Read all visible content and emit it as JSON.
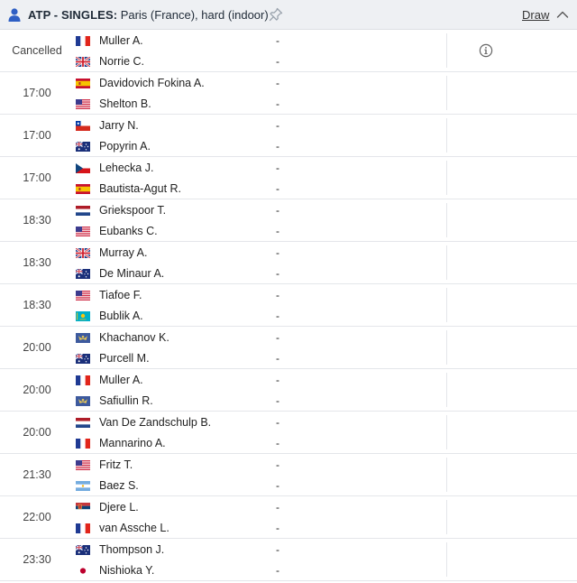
{
  "header": {
    "category": "ATP - SINGLES",
    "separator": ":",
    "tournament": "Paris (France), hard (indoor)",
    "draw_label": "Draw",
    "icons": {
      "person": "person-icon",
      "pin": "pin-icon",
      "collapse": "chevron-up-icon"
    },
    "accent_color": "#2e5fc4"
  },
  "matches": [
    {
      "time": "Cancelled",
      "p1": {
        "name": "Muller A.",
        "flag": "fr",
        "score": "-"
      },
      "p2": {
        "name": "Norrie C.",
        "flag": "gb",
        "score": "-"
      },
      "info_icon": "info-icon"
    },
    {
      "time": "17:00",
      "p1": {
        "name": "Davidovich Fokina A.",
        "flag": "es",
        "score": "-"
      },
      "p2": {
        "name": "Shelton B.",
        "flag": "us",
        "score": "-"
      }
    },
    {
      "time": "17:00",
      "p1": {
        "name": "Jarry N.",
        "flag": "cl",
        "score": "-"
      },
      "p2": {
        "name": "Popyrin A.",
        "flag": "au",
        "score": "-"
      }
    },
    {
      "time": "17:00",
      "p1": {
        "name": "Lehecka J.",
        "flag": "cz",
        "score": "-"
      },
      "p2": {
        "name": "Bautista-Agut R.",
        "flag": "es",
        "score": "-"
      }
    },
    {
      "time": "18:30",
      "p1": {
        "name": "Griekspoor T.",
        "flag": "nl",
        "score": "-"
      },
      "p2": {
        "name": "Eubanks C.",
        "flag": "us",
        "score": "-"
      }
    },
    {
      "time": "18:30",
      "p1": {
        "name": "Murray A.",
        "flag": "gb",
        "score": "-"
      },
      "p2": {
        "name": "De Minaur A.",
        "flag": "au",
        "score": "-"
      }
    },
    {
      "time": "18:30",
      "p1": {
        "name": "Tiafoe F.",
        "flag": "us",
        "score": "-"
      },
      "p2": {
        "name": "Bublik A.",
        "flag": "kz",
        "score": "-"
      }
    },
    {
      "time": "20:00",
      "p1": {
        "name": "Khachanov K.",
        "flag": "neutral",
        "score": "-"
      },
      "p2": {
        "name": "Purcell M.",
        "flag": "au",
        "score": "-"
      }
    },
    {
      "time": "20:00",
      "p1": {
        "name": "Muller A.",
        "flag": "fr",
        "score": "-"
      },
      "p2": {
        "name": "Safiullin R.",
        "flag": "neutral",
        "score": "-"
      }
    },
    {
      "time": "20:00",
      "p1": {
        "name": "Van De Zandschulp B.",
        "flag": "nl",
        "score": "-"
      },
      "p2": {
        "name": "Mannarino A.",
        "flag": "fr",
        "score": "-"
      }
    },
    {
      "time": "21:30",
      "p1": {
        "name": "Fritz T.",
        "flag": "us",
        "score": "-"
      },
      "p2": {
        "name": "Baez S.",
        "flag": "ar",
        "score": "-"
      }
    },
    {
      "time": "22:00",
      "p1": {
        "name": "Djere L.",
        "flag": "rs",
        "score": "-"
      },
      "p2": {
        "name": "van Assche L.",
        "flag": "fr",
        "score": "-"
      }
    },
    {
      "time": "23:30",
      "p1": {
        "name": "Thompson J.",
        "flag": "au",
        "score": "-"
      },
      "p2": {
        "name": "Nishioka Y.",
        "flag": "jp",
        "score": "-"
      }
    }
  ]
}
